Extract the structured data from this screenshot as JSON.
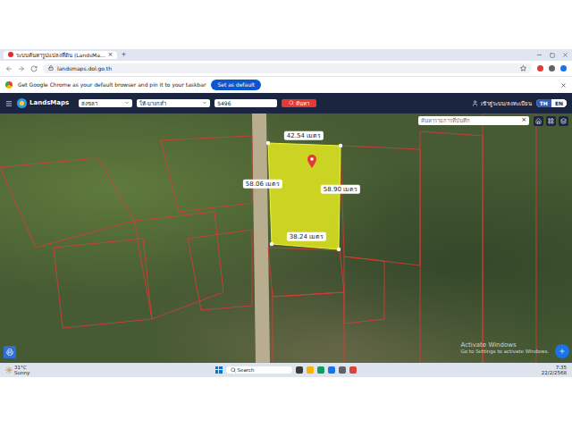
{
  "browser": {
    "tab_title": "ระบบค้นหารูปแปลงที่ดิน (LandsMa...",
    "tab_close": "×",
    "new_tab": "+",
    "url": "landsmaps.dol.go.th"
  },
  "infobar": {
    "message": "Get Google Chrome as your default browser and pin it to your taskbar",
    "button": "Set as default"
  },
  "app_header": {
    "logo": "LandsMaps",
    "province": "สงขลา",
    "district": "ให้-บางกล่ำ",
    "parcel_number": "5496",
    "search_button": "ค้นหา",
    "login": "เข้าสู่ระบบ/ลงทะเบียน",
    "languages": [
      {
        "label": "TH",
        "selected": true
      },
      {
        "label": "EN",
        "selected": false
      }
    ]
  },
  "map": {
    "search_placeholder": "ค้นหารายการที่บันทึก",
    "search_clear": "×",
    "measurements": {
      "top": "42.54 เมตร",
      "left": "58.06 เมตร",
      "right": "58.90 เมตร",
      "bottom": "38.24 เมตร"
    },
    "watermark": [
      "Activate Windows",
      "Go to Settings to activate Windows."
    ]
  },
  "taskbar": {
    "weather_temp": "31°C",
    "weather_text": "Sunny",
    "search": "Search",
    "time": "7:35",
    "date": "22/2/2568"
  }
}
